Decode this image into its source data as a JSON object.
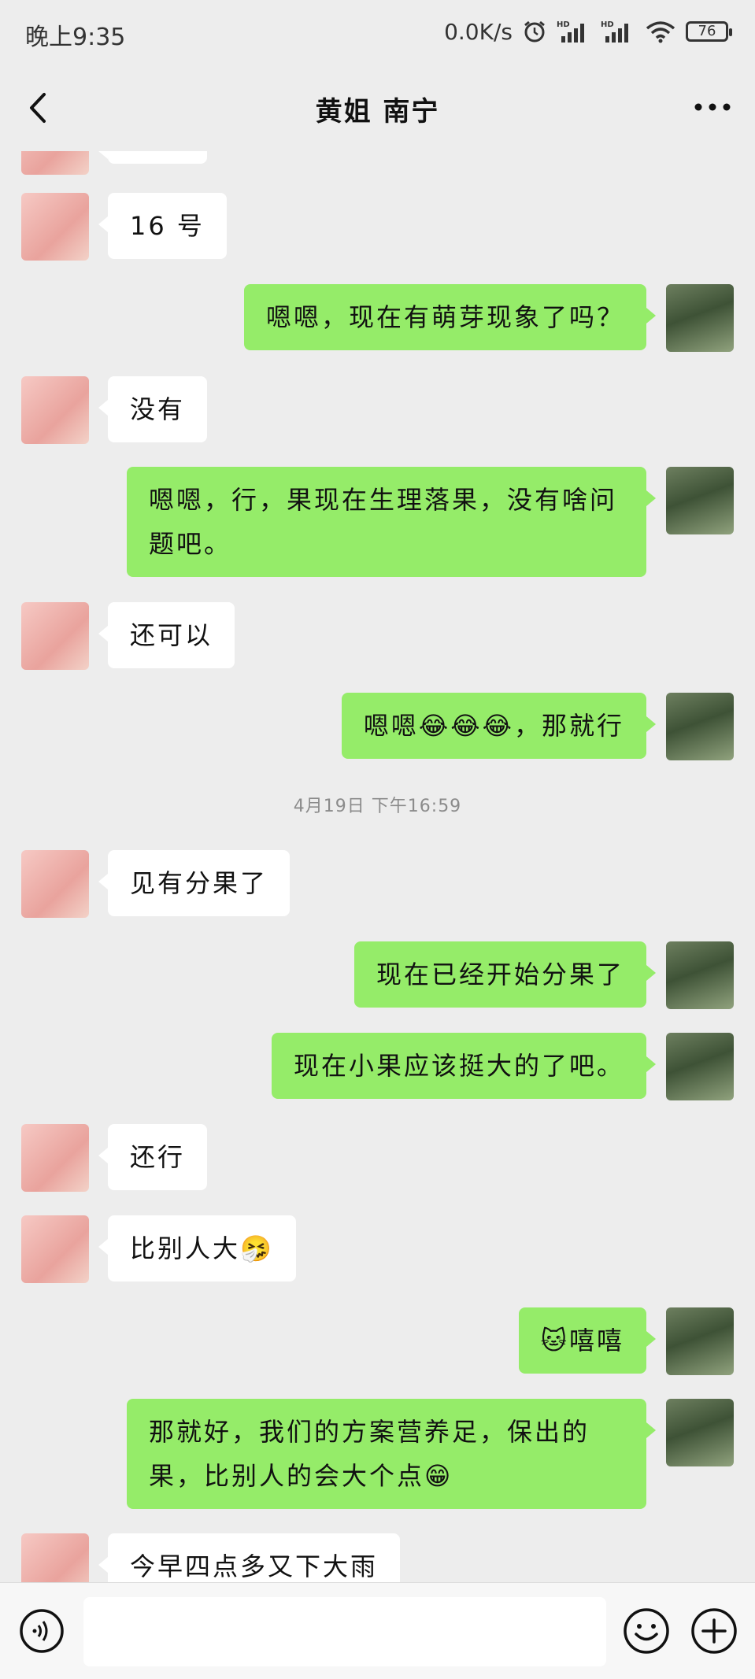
{
  "status_bar": {
    "time": "晚上9:35",
    "speed": "0.0K/s",
    "battery": "76"
  },
  "header": {
    "title": "黄姐 南宁"
  },
  "messages": [
    {
      "side": "left",
      "text": "16 号"
    },
    {
      "side": "right",
      "text": "嗯嗯，现在有萌芽现象了吗？"
    },
    {
      "side": "left",
      "text": "没有"
    },
    {
      "side": "right",
      "text": "嗯嗯，行，果现在生理落果，没有啥问题吧。"
    },
    {
      "side": "left",
      "text": "还可以"
    },
    {
      "side": "right",
      "text": "嗯嗯😂😂😂，那就行"
    },
    {
      "side": "left",
      "text": "见有分果了"
    },
    {
      "side": "right",
      "text": "现在已经开始分果了"
    },
    {
      "side": "right",
      "text": "现在小果应该挺大的了吧。"
    },
    {
      "side": "left",
      "text": "还行"
    },
    {
      "side": "left",
      "text": "比别人大🤧"
    },
    {
      "side": "right",
      "text": "🐱嘻嘻"
    },
    {
      "side": "right",
      "text": "那就好，我们的方案营养足，保出的果，比别人的会大个点😁"
    },
    {
      "side": "left",
      "text": "今早四点多又下大雨"
    }
  ],
  "timestamp": "4月19日 下午16:59",
  "icons": {
    "back": "chevron-left-icon",
    "more": "more-dots-icon",
    "voice": "voice-icon",
    "emoji": "emoji-icon",
    "plus": "plus-icon"
  },
  "colors": {
    "background": "#ededed",
    "sent_bubble": "#95ec69",
    "received_bubble": "#ffffff"
  }
}
